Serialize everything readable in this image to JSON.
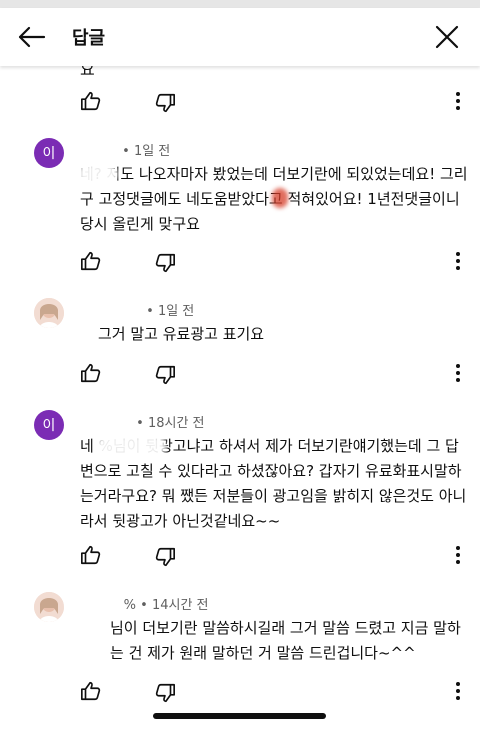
{
  "header": {
    "back_icon": "arrow-left-icon",
    "title": "답글",
    "close_icon": "close-icon"
  },
  "top_fragment": "요",
  "comments": [
    {
      "avatar_initial": "이",
      "avatar_color": "#7b2cb4",
      "name": "",
      "time": "• 1일 전",
      "text": "네? 저도 나오자마자 봤었는데 더보기란에 되있었는데요! 그리구 고정댓글에도 네도움받았다고 적혀있어요! 1년전댓글이니 당시 올린게 맞구요"
    },
    {
      "avatar_initial": "",
      "avatar_color": "#f2dcd2",
      "name": "",
      "time": "• 1일 전",
      "text": "그거 말고 유료광고 표기요"
    },
    {
      "avatar_initial": "이",
      "avatar_color": "#7b2cb4",
      "name": "",
      "time": "• 18시간 전",
      "text": "네 %님이 뒷광고냐고 하셔서 제가 더보기란얘기했는데 그 답변으로 고칠 수 있다라고 하셨잖아요? 갑자기 유료화표시말하는거라구요?  뭐 쨌든 저분들이 광고임을 밝히지 않은것도 아니라서 뒷광고가 아닌것같네요~~"
    },
    {
      "avatar_initial": "",
      "avatar_color": "#f2dcd2",
      "name": "%",
      "time": "• 14시간 전",
      "text": "님이 더보기란 말씀하시길래 그거 말씀 드렸고 지금 말하는 건 제가 원래 말하던 거 말씀 드린겁니다~^^"
    }
  ],
  "icons": {
    "like": "thumbs-up-icon",
    "dislike": "thumbs-down-icon",
    "more": "more-vertical-icon"
  }
}
